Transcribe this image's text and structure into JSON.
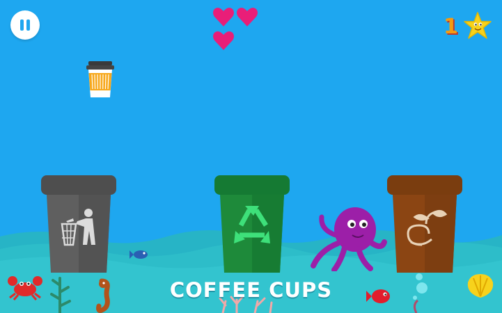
{
  "hud": {
    "pause_icon": "pause-icon",
    "lives": 3,
    "score": "1",
    "score_icon": "starfish-icon"
  },
  "falling_item": {
    "icon": "coffee-cup-icon",
    "label": "COFFEE CUPS"
  },
  "bins": [
    {
      "type": "landfill",
      "icon": "trash-person-icon",
      "color": "#5a5a5a"
    },
    {
      "type": "recycling",
      "icon": "recycle-icon",
      "color": "#1e8a3a"
    },
    {
      "type": "compost",
      "icon": "compost-sprout-icon",
      "color": "#8b4513"
    }
  ],
  "colors": {
    "sky": "#1ea7f0",
    "sea": "#2dbdc9",
    "heart": "#e91e78",
    "score": "#f39c12"
  }
}
